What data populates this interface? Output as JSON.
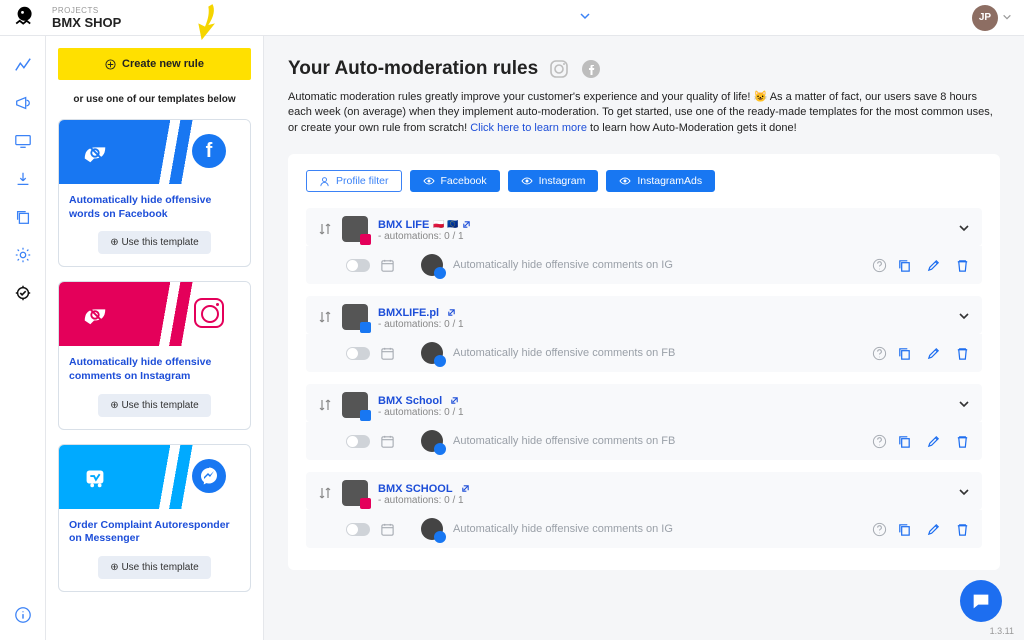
{
  "header": {
    "projects_label": "PROJECTS",
    "project_name": "BMX SHOP",
    "avatar_initials": "JP"
  },
  "sidebar": {
    "create_label": "Create new rule",
    "or_text": "or use one of our templates below",
    "templates": [
      {
        "title": "Automatically hide offensive words on Facebook",
        "cta": "Use this template"
      },
      {
        "title": "Automatically hide offensive comments on Instagram",
        "cta": "Use this template"
      },
      {
        "title": "Order Complaint Autoresponder on Messenger",
        "cta": "Use this template"
      }
    ]
  },
  "main": {
    "title": "Your Auto-moderation rules",
    "desc_1": "Automatic moderation rules greatly improve your customer's experience and your quality of life! ",
    "desc_2": " As a matter of fact, our users save 8 hours each week (on average) when they implement auto-moderation. To get started, use one of the ready-made templates for the most common uses, or create your own rule from scratch! ",
    "desc_link": "Click here to learn more",
    "desc_3": " to learn how Auto-Moderation gets it done!",
    "filters": {
      "profile": "Profile filter",
      "facebook": "Facebook",
      "instagram": "Instagram",
      "instagram_ads": "InstagramAds"
    },
    "profiles": [
      {
        "name": "BMX LIFE",
        "flags": "🇵🇱 🇪🇺",
        "sub": "- automations: 0 / 1",
        "network": "ig",
        "rule": "Automatically hide offensive comments on IG"
      },
      {
        "name": "BMXLIFE.pl",
        "flags": "",
        "sub": "- automations: 0 / 1",
        "network": "fb",
        "rule": "Automatically hide offensive comments on FB"
      },
      {
        "name": "BMX School",
        "flags": "",
        "sub": "- automations: 0 / 1",
        "network": "fb",
        "rule": "Automatically hide offensive comments on FB"
      },
      {
        "name": "BMX SCHOOL",
        "flags": "",
        "sub": "- automations: 0 / 1",
        "network": "ig",
        "rule": "Automatically hide offensive comments on IG"
      }
    ]
  },
  "version": "1.3.11"
}
